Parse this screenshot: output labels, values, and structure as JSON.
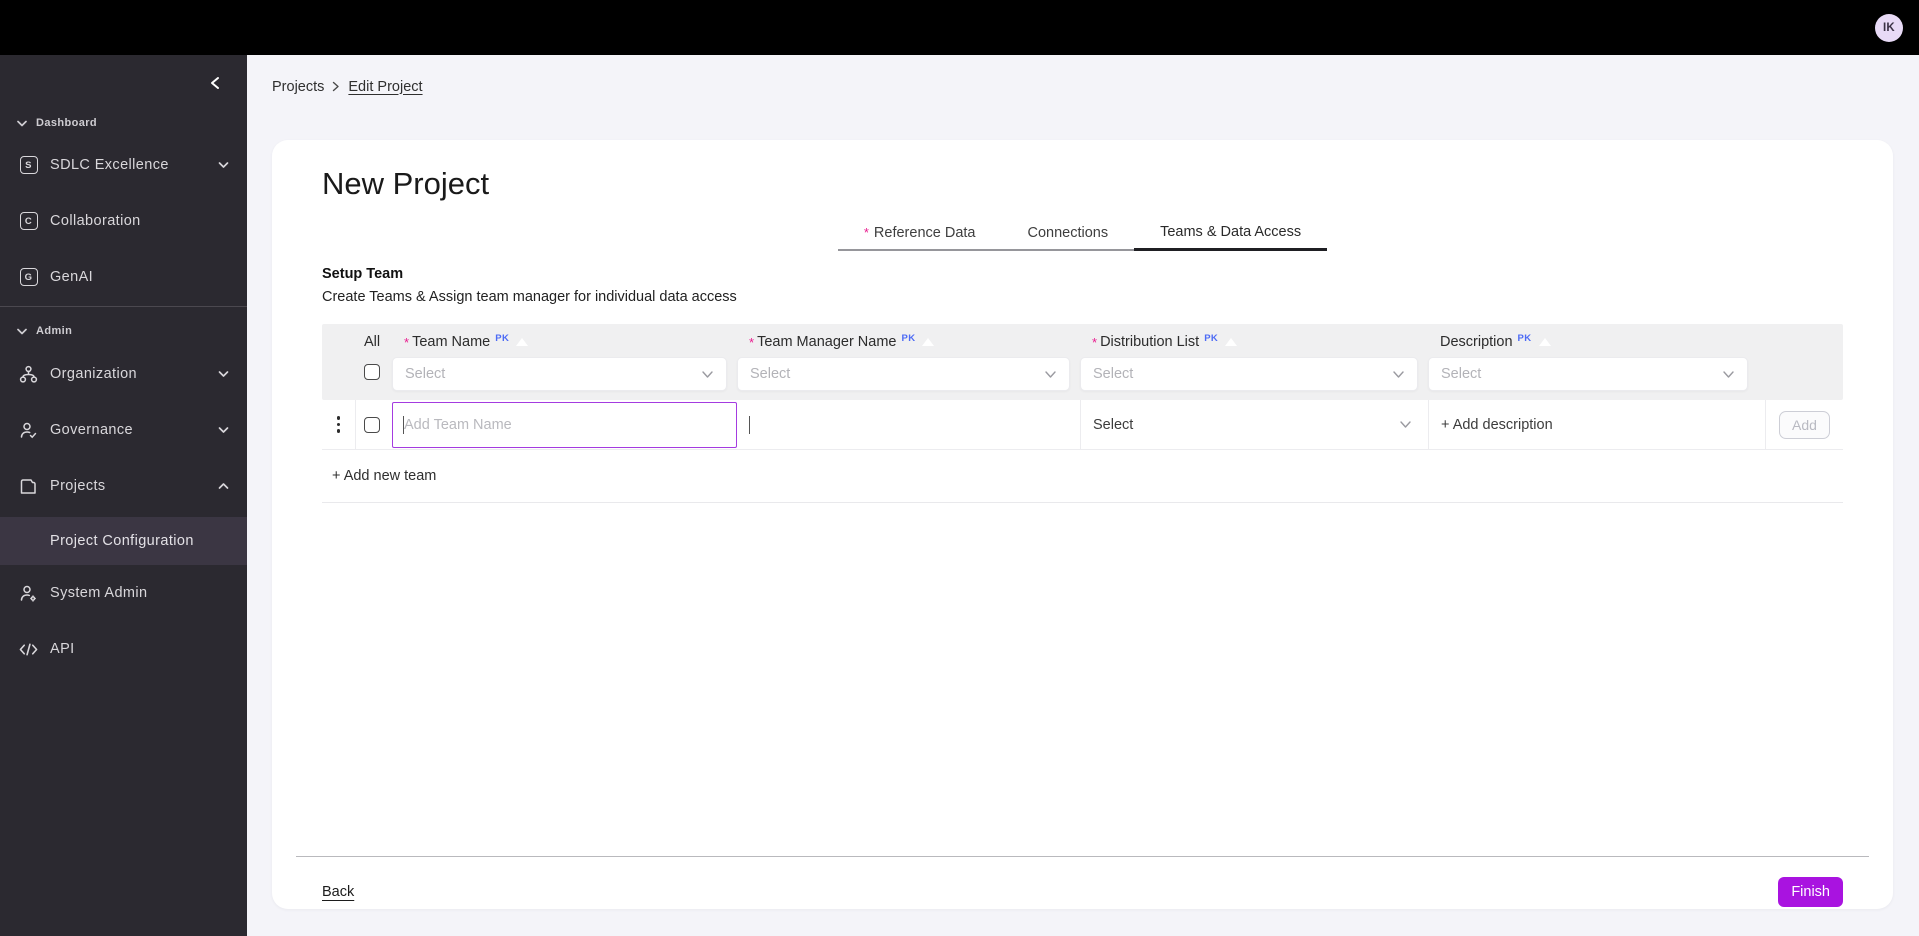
{
  "topbar": {
    "avatar_initials": "IK"
  },
  "sidebar": {
    "dashboard_label": "Dashboard",
    "items": [
      {
        "label": "SDLC Excellence",
        "badge": "S"
      },
      {
        "label": "Collaboration",
        "badge": "C"
      },
      {
        "label": "GenAI",
        "badge": "G"
      }
    ],
    "admin_label": "Admin",
    "admin_items": [
      {
        "label": "Organization"
      },
      {
        "label": "Governance"
      },
      {
        "label": "Projects"
      },
      {
        "label": "Project Configuration"
      },
      {
        "label": "System Admin"
      },
      {
        "label": "API"
      }
    ]
  },
  "breadcrumb": {
    "root": "Projects",
    "current": "Edit Project"
  },
  "main": {
    "title": "New Project",
    "tabs": [
      {
        "label": "Reference Data",
        "marker": "*"
      },
      {
        "label": "Connections",
        "marker": ""
      },
      {
        "label": "Teams & Data Access",
        "marker": ""
      }
    ],
    "setup_heading": "Setup Team",
    "setup_subheading": "Create Teams & Assign team manager for individual data access",
    "table": {
      "select_all_label": "All",
      "columns": [
        {
          "marker": "*",
          "label": "Team Name",
          "badge": "PK",
          "filter_placeholder": "Select"
        },
        {
          "marker": "*",
          "label": "Team Manager Name",
          "badge": "PK",
          "filter_placeholder": "Select"
        },
        {
          "marker": "*",
          "label": "Distribution List",
          "badge": "PK",
          "filter_placeholder": "Select"
        },
        {
          "marker": "",
          "label": "Description",
          "badge": "PK",
          "filter_placeholder": "Select"
        }
      ],
      "row": {
        "team_name_placeholder": "Add Team Name",
        "team_name_value": "",
        "manager_value": "",
        "distribution_value": "Select",
        "description_label": "+ Add description",
        "add_button_label": "Add"
      },
      "add_new_team_label": "+ Add new team"
    },
    "footer": {
      "back_label": "Back",
      "finish_label": "Finish"
    }
  },
  "colors": {
    "accent_purple": "#a913e0",
    "focus_border_purple": "#a43be0",
    "required_pink": "#e91e8f",
    "pk_blue": "#4d6bf5",
    "sidebar_bg": "#2b2930",
    "topbar_bg": "#000000"
  }
}
